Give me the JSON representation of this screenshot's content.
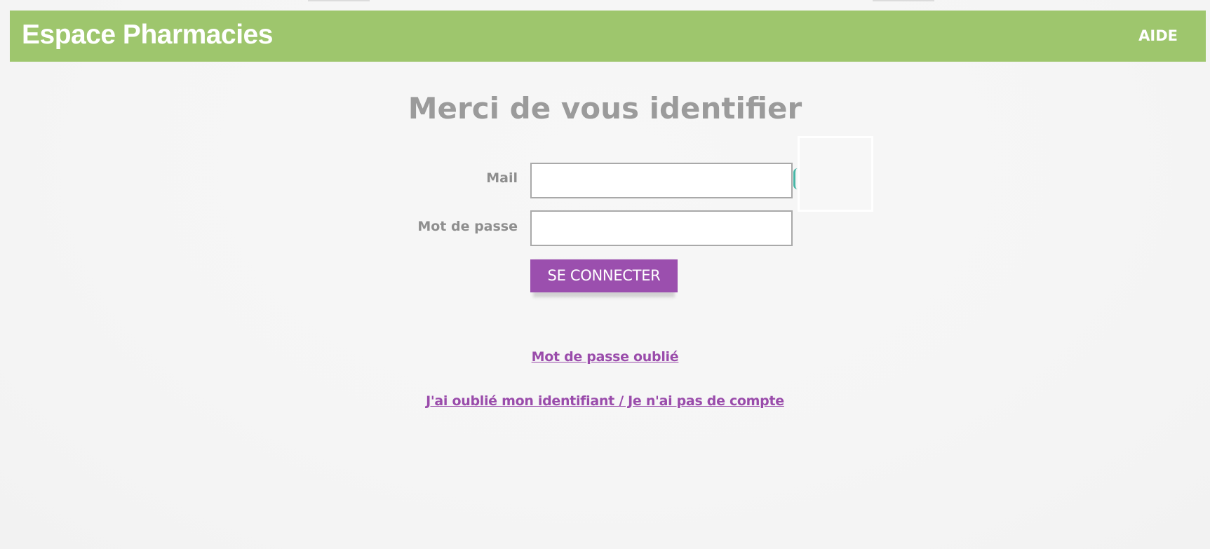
{
  "header": {
    "brand": "Espace Pharmacies",
    "help_label": "AIDE"
  },
  "login": {
    "title": "Merci de vous identifier",
    "mail_label": "Mail",
    "mail_value": "",
    "password_label": "Mot de passe",
    "password_value": "",
    "submit_label": "SE CONNECTER"
  },
  "links": {
    "forgot_password": "Mot de passe oublié",
    "forgot_id_no_account": "J'ai oublié mon identifiant / Je n'ai pas de compte"
  },
  "colors": {
    "header_green": "#9ec66d",
    "accent_purple": "#9b4fae",
    "title_grey": "#9b9b9b"
  }
}
